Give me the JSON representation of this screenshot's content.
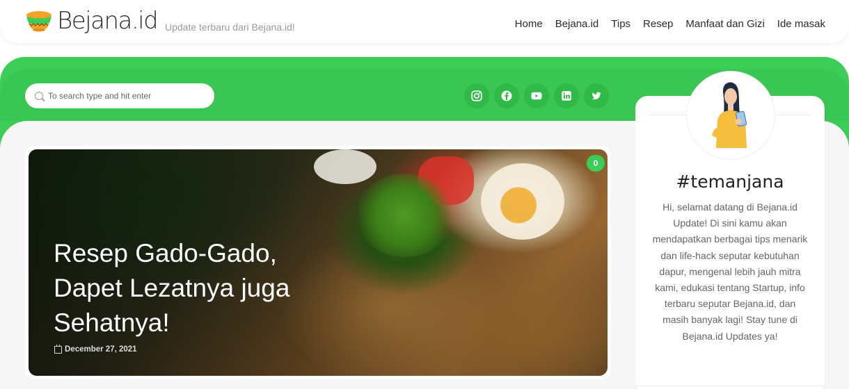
{
  "header": {
    "brand": "Bejana.id",
    "tagline": "Update terbaru dari Bejana.id!",
    "nav": [
      "Home",
      "Bejana.id",
      "Tips",
      "Resep",
      "Manfaat dan Gizi",
      "Ide masak"
    ]
  },
  "search": {
    "placeholder": "To search type and hit enter"
  },
  "socials": [
    "instagram-icon",
    "facebook-icon",
    "youtube-icon",
    "linkedin-icon",
    "twitter-icon"
  ],
  "hero": {
    "title": "Resep Gado-Gado, Dapet Lezatnya juga Sehatnya!",
    "date": "December 27, 2021",
    "comments": "0"
  },
  "widget": {
    "title": "#temanjana",
    "text": "Hi, selamat datang di Bejana.id Update! Di sini kamu akan mendapatkan berbagai tips menarik dan life-hack seputar kebutuhan dapur, mengenal lebih jauh mitra kami, edukasi tentang Startup, info terbaru seputar Bejana.id, dan masih banyak lagi! Stay tune di Bejana.id Updates ya!"
  },
  "colors": {
    "accent": "#3bcd55",
    "accent_dark": "#2fb947"
  }
}
